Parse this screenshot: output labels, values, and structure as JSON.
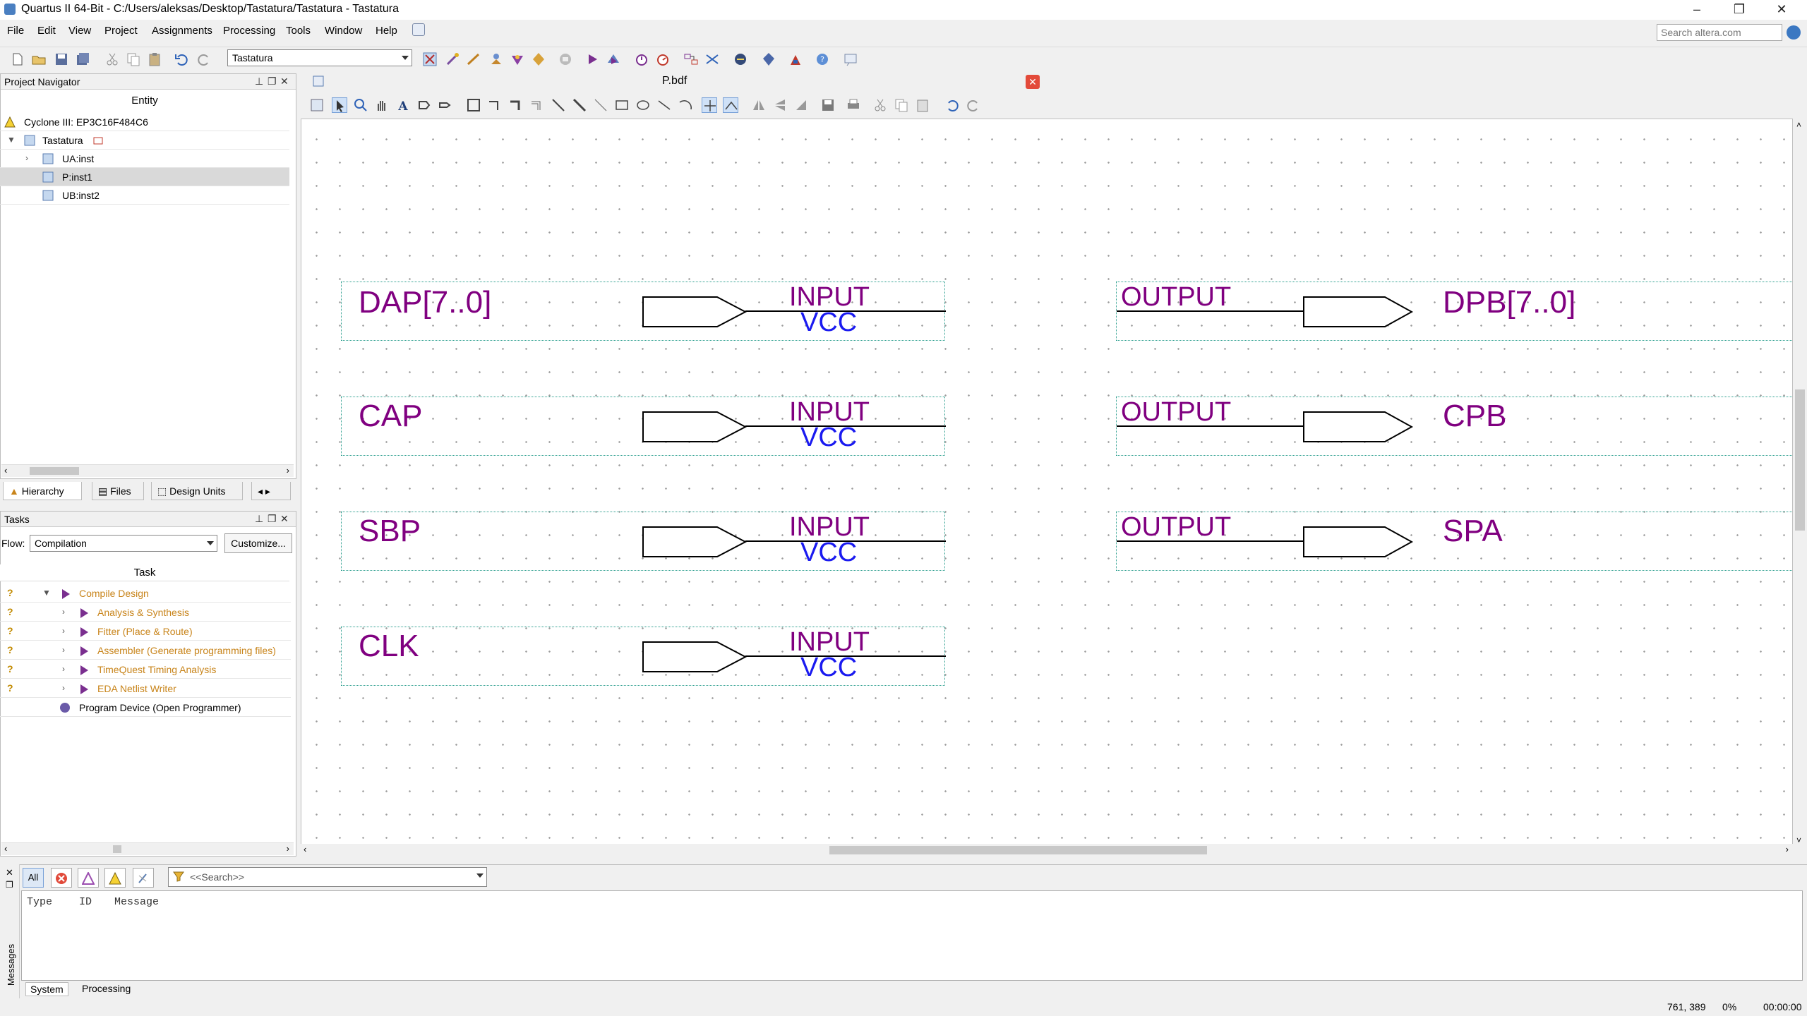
{
  "window": {
    "title": "Quartus II 64-Bit - C:/Users/aleksas/Desktop/Tastatura/Tastatura - Tastatura",
    "minimize": "–",
    "restore": "❐",
    "close": "✕"
  },
  "menu": [
    "File",
    "Edit",
    "View",
    "Project",
    "Assignments",
    "Processing",
    "Tools",
    "Window",
    "Help"
  ],
  "search": {
    "placeholder": "Search altera.com"
  },
  "toolbar": {
    "project_select": "Tastatura"
  },
  "project_navigator": {
    "title": "Project Navigator",
    "column": "Entity",
    "device": "Cyclone III: EP3C16F484C6",
    "root": "Tastatura",
    "children": [
      "UA:inst",
      "P:inst1",
      "UB:inst2"
    ],
    "tabs": [
      "Hierarchy",
      "Files",
      "Design Units"
    ]
  },
  "tasks": {
    "title": "Tasks",
    "flow_label": "Flow:",
    "flow_value": "Compilation",
    "customize": "Customize...",
    "column": "Task",
    "items": [
      "Compile Design",
      "Analysis & Synthesis",
      "Fitter (Place & Route)",
      "Assembler (Generate programming files)",
      "TimeQuest Timing Analysis",
      "EDA Netlist Writer",
      "Program Device (Open Programmer)"
    ],
    "status_mark": "?"
  },
  "document": {
    "tab": "P.bdf",
    "close": "✕"
  },
  "schematic": {
    "inputs": [
      {
        "name": "DAP[7..0]",
        "type": "INPUT",
        "default": "VCC"
      },
      {
        "name": "CAP",
        "type": "INPUT",
        "default": "VCC"
      },
      {
        "name": "SBP",
        "type": "INPUT",
        "default": "VCC"
      },
      {
        "name": "CLK",
        "type": "INPUT",
        "default": "VCC"
      }
    ],
    "outputs": [
      {
        "name": "DPB[7..0]",
        "type": "OUTPUT"
      },
      {
        "name": "CPB",
        "type": "OUTPUT"
      },
      {
        "name": "SPA",
        "type": "OUTPUT"
      }
    ]
  },
  "messages": {
    "side_label": "Messages",
    "filter_all": "All",
    "search_placeholder": "<<Search>>",
    "columns": [
      "Type",
      "ID",
      "Message"
    ],
    "tabs": [
      "System",
      "Processing"
    ]
  },
  "status": {
    "coords": "761, 389",
    "percent": "0%",
    "time": "00:00:00"
  }
}
